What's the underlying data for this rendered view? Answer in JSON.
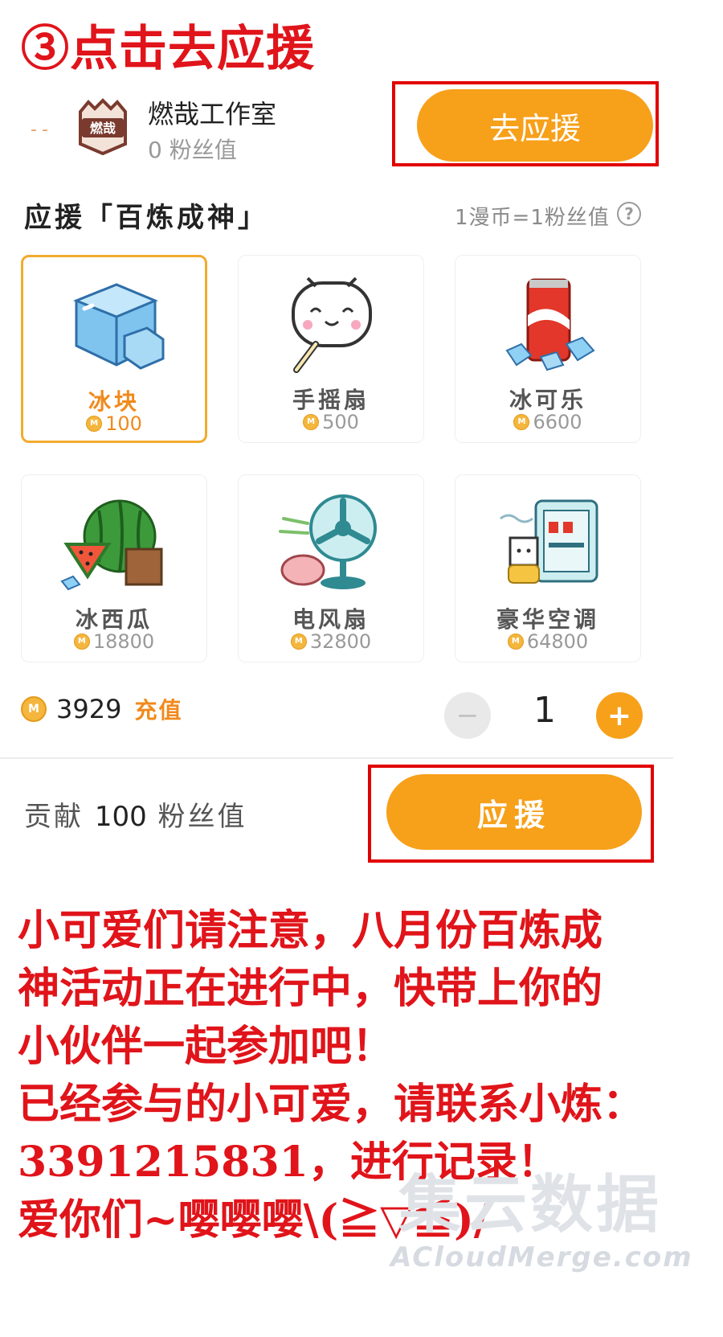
{
  "step_title": "③点击去应援",
  "studio": {
    "name": "燃哉工作室",
    "fans": "0 粉丝值",
    "logo_text": "燃哉",
    "goto_button": "去应援"
  },
  "support": {
    "title": "应援「百炼成神」",
    "rate": "1漫币=1粉丝值",
    "help": "?"
  },
  "gifts": [
    {
      "name": "冰块",
      "price": "100",
      "selected": true
    },
    {
      "name": "手摇扇",
      "price": "500",
      "selected": false
    },
    {
      "name": "冰可乐",
      "price": "6600",
      "selected": false
    },
    {
      "name": "冰西瓜",
      "price": "18800",
      "selected": false
    },
    {
      "name": "电风扇",
      "price": "32800",
      "selected": false
    },
    {
      "name": "豪华空调",
      "price": "64800",
      "selected": false
    }
  ],
  "wallet": {
    "balance": "3929",
    "recharge": "充值"
  },
  "stepper": {
    "minus": "−",
    "quantity": "1",
    "plus": "+"
  },
  "contribution": {
    "prefix": "贡献",
    "value": "100",
    "suffix": "粉丝值"
  },
  "support_button": "应援",
  "notice_lines": [
    "小可爱们请注意，八月份百炼成",
    "神活动正在进行中，快带上你的",
    "小伙伴一起参加吧！",
    "已经参与的小可爱，请联系小炼：",
    "3391215831，进行记录！",
    "爱你们~嘤嘤嘤\\(≧▽≦)/"
  ],
  "watermark": {
    "cn": "集云数据",
    "en": "ACloudMerge.com"
  },
  "colors": {
    "accent": "#f7a01a",
    "highlight_box": "#e10000",
    "notice_text": "#e0141a"
  }
}
